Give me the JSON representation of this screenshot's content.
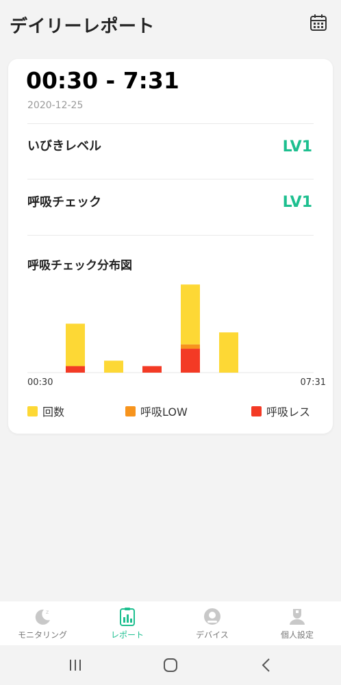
{
  "header": {
    "title": "デイリーレポート",
    "calendar_icon": "calendar-icon"
  },
  "report": {
    "time_range": "00:30 - 7:31",
    "date": "2020-12-25",
    "snore_level": {
      "label": "いびきレベル",
      "value": "LV1"
    },
    "breath_check": {
      "label": "呼吸チェック",
      "value": "LV1"
    }
  },
  "chart_data": {
    "type": "bar",
    "title": "呼吸チェック分布図",
    "stacked": true,
    "x_start_label": "00:30",
    "x_end_label": "07:31",
    "categories": [
      "1",
      "2",
      "3",
      "4",
      "5",
      "6"
    ],
    "series": [
      {
        "name": "呼吸レス",
        "color": "#f33a25",
        "values": [
          6,
          0,
          6,
          22,
          0,
          0
        ]
      },
      {
        "name": "呼吸LOW",
        "color": "#f7941d",
        "values": [
          0,
          0,
          0,
          4,
          0,
          0
        ]
      },
      {
        "name": "回数",
        "color": "#fdd835",
        "values": [
          39,
          11,
          0,
          55,
          37,
          0
        ]
      }
    ],
    "ylim": [
      0,
      85
    ],
    "grid": false,
    "legend": "bottom"
  },
  "legend": [
    {
      "label": "回数",
      "color": "#fdd835"
    },
    {
      "label": "呼吸LOW",
      "color": "#f7941d"
    },
    {
      "label": "呼吸レス",
      "color": "#f33a25"
    }
  ],
  "bottom_nav": [
    {
      "label": "モニタリング",
      "icon": "moon-sleep-icon",
      "active": false
    },
    {
      "label": "レポート",
      "icon": "clipboard-chart-icon",
      "active": true
    },
    {
      "label": "デバイス",
      "icon": "device-icon",
      "active": false
    },
    {
      "label": "個人設定",
      "icon": "person-icon",
      "active": false
    }
  ],
  "system_nav": [
    "recent-apps-icon",
    "home-icon",
    "back-icon"
  ],
  "colors": {
    "accent": "#1dbf8f",
    "background": "#f3f3f3"
  }
}
